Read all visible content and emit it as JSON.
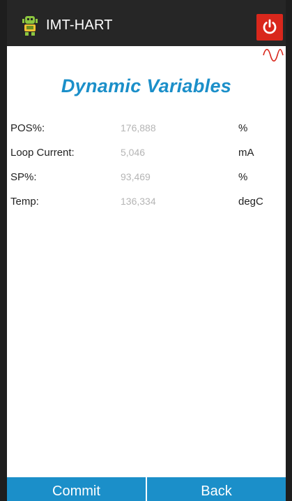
{
  "header": {
    "app_title": "IMT-HART",
    "logo_icon": "robot-icon",
    "power_icon": "power-icon"
  },
  "signal_icon": "sine-wave-icon",
  "page_title": "Dynamic Variables",
  "variables": [
    {
      "label": "POS%:",
      "value": "176,888",
      "unit": "%"
    },
    {
      "label": "Loop Current:",
      "value": "5,046",
      "unit": "mA"
    },
    {
      "label": "SP%:",
      "value": "93,469",
      "unit": "%"
    },
    {
      "label": "Temp:",
      "value": "136,334",
      "unit": "degC"
    }
  ],
  "buttons": {
    "commit_label": "Commit",
    "back_label": "Back"
  },
  "colors": {
    "accent": "#1b8fc9",
    "appbar": "#262626",
    "power": "#d9271c",
    "value_text": "#b5b5b5"
  }
}
